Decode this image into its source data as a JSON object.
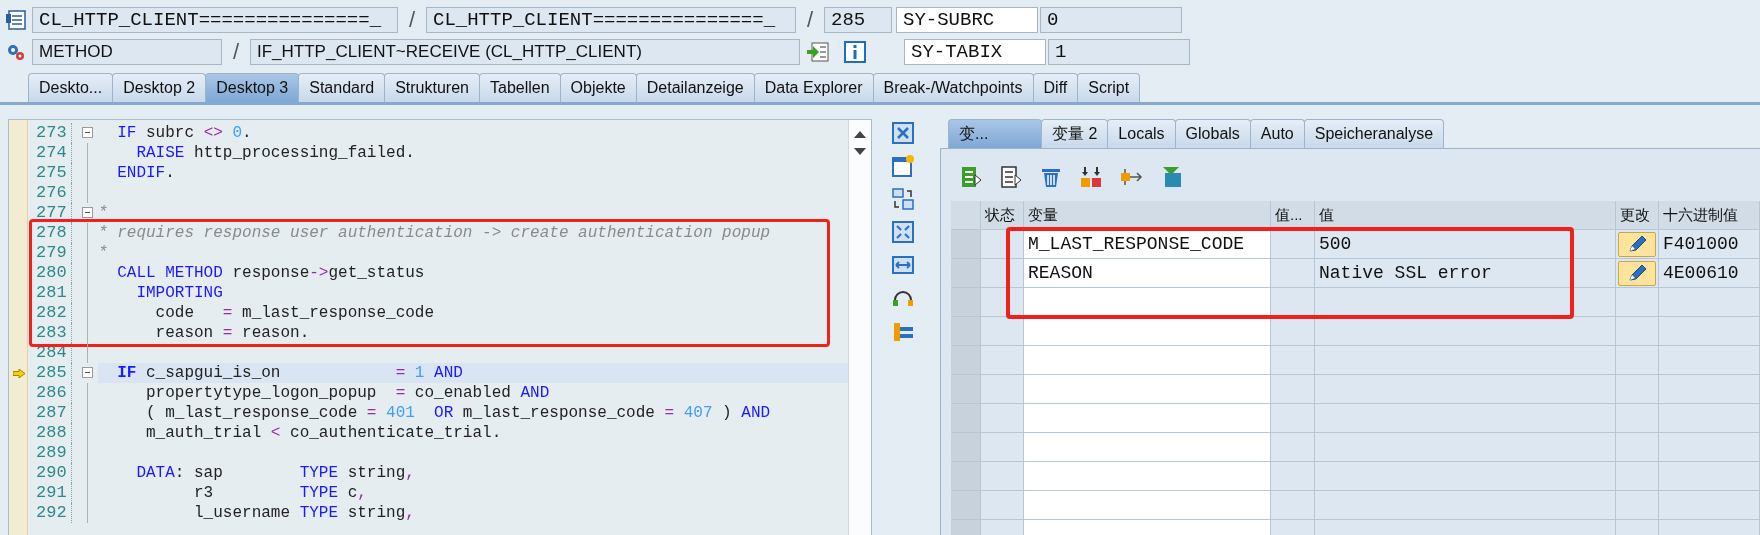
{
  "header": {
    "row_1": [
      {
        "kind": "field",
        "value": "CL_HTTP_CLIENT===============_"
      },
      {
        "kind": "separator",
        "text": "/"
      },
      {
        "kind": "field",
        "value": "CL_HTTP_CLIENT===============_"
      },
      {
        "kind": "separator",
        "text": "/"
      },
      {
        "kind": "field",
        "value": "285"
      }
    ],
    "row_2": [
      {
        "kind": "field",
        "value": "METHOD"
      },
      {
        "kind": "separator",
        "text": "/"
      },
      {
        "kind": "field",
        "value": "IF_HTTP_CLIENT~RECEIVE (CL_HTTP_CLIENT)"
      }
    ],
    "system_fields": [
      {
        "name": "SY-SUBRC",
        "value": "0"
      },
      {
        "name": "SY-TABIX",
        "value": "1"
      }
    ]
  },
  "tabs": [
    {
      "label": "Deskto...",
      "selected": false
    },
    {
      "label": "Desktop 2",
      "selected": false
    },
    {
      "label": "Desktop 3",
      "selected": true
    },
    {
      "label": "Standard",
      "selected": false
    },
    {
      "label": "Strukturen",
      "selected": false
    },
    {
      "label": "Tabellen",
      "selected": false
    },
    {
      "label": "Objekte",
      "selected": false
    },
    {
      "label": "Detailanzeige",
      "selected": false
    },
    {
      "label": "Data Explorer",
      "selected": false
    },
    {
      "label": "Break-/Watchpoints",
      "selected": false
    },
    {
      "label": "Diff",
      "selected": false
    },
    {
      "label": "Script",
      "selected": false
    }
  ],
  "code": {
    "blocks": [
      {
        "framed": false,
        "lines": [
          {
            "number": "273",
            "collapsible": true,
            "current": false,
            "tokens": [
              {
                "kind": "kw",
                "text": "  IF"
              },
              {
                "kind": "txt",
                "text": " subrc "
              },
              {
                "kind": "op",
                "text": "<>"
              },
              {
                "kind": "num",
                "text": " 0"
              },
              {
                "kind": "txt",
                "text": "."
              }
            ]
          },
          {
            "number": "274",
            "collapsible": false,
            "current": false,
            "tokens": [
              {
                "kind": "kw",
                "text": "    RAISE"
              },
              {
                "kind": "txt",
                "text": " http_processing_failed."
              }
            ]
          },
          {
            "number": "275",
            "collapsible": false,
            "current": false,
            "tokens": [
              {
                "kind": "kw",
                "text": "  ENDIF"
              },
              {
                "kind": "txt",
                "text": "."
              }
            ]
          },
          {
            "number": "276",
            "collapsible": false,
            "current": false
          },
          {
            "number": "277",
            "collapsible": true,
            "current": false,
            "tokens": [
              {
                "kind": "cmt",
                "text": "*"
              }
            ]
          }
        ]
      },
      {
        "framed": true,
        "lines": [
          {
            "number": "278",
            "collapsible": false,
            "current": false,
            "tokens": [
              {
                "kind": "cmt",
                "text": "* requires response user authentication -> create authentication popup"
              }
            ]
          },
          {
            "number": "279",
            "collapsible": false,
            "current": false,
            "tokens": [
              {
                "kind": "cmt",
                "text": "*"
              }
            ]
          },
          {
            "number": "280",
            "collapsible": false,
            "current": false,
            "tokens": [
              {
                "kind": "kw",
                "text": "  CALL METHOD"
              },
              {
                "kind": "txt",
                "text": " response"
              },
              {
                "kind": "op",
                "text": "->"
              },
              {
                "kind": "txt",
                "text": "get_status"
              }
            ]
          },
          {
            "number": "281",
            "collapsible": false,
            "current": false,
            "tokens": [
              {
                "kind": "kw",
                "text": "    IMPORTING"
              }
            ]
          },
          {
            "number": "282",
            "collapsible": false,
            "current": false,
            "tokens": [
              {
                "kind": "txt",
                "text": "      code   "
              },
              {
                "kind": "op",
                "text": "="
              },
              {
                "kind": "txt",
                "text": " m_last_response_code"
              }
            ]
          },
          {
            "number": "283",
            "collapsible": false,
            "current": false,
            "tokens": [
              {
                "kind": "txt",
                "text": "      reason "
              },
              {
                "kind": "op",
                "text": "="
              },
              {
                "kind": "txt",
                "text": " reason."
              }
            ]
          }
        ]
      },
      {
        "framed": false,
        "lines": [
          {
            "number": "284",
            "collapsible": false,
            "current": false
          },
          {
            "number": "285",
            "collapsible": true,
            "current": true,
            "tokens": [
              {
                "kind": "kw",
                "text": "  IF"
              },
              {
                "kind": "txt",
                "text": " c_sapgui_is_on            "
              },
              {
                "kind": "op",
                "text": "="
              },
              {
                "kind": "num",
                "text": " 1"
              },
              {
                "kind": "kw",
                "text": " AND"
              }
            ]
          },
          {
            "number": "286",
            "collapsible": false,
            "current": false,
            "tokens": [
              {
                "kind": "txt",
                "text": "     propertytype_logon_popup  "
              },
              {
                "kind": "op",
                "text": "="
              },
              {
                "kind": "txt",
                "text": " co_enabled "
              },
              {
                "kind": "kw",
                "text": "AND"
              }
            ]
          },
          {
            "number": "287",
            "collapsible": false,
            "current": false,
            "tokens": [
              {
                "kind": "txt",
                "text": "     ( m_last_response_code "
              },
              {
                "kind": "op",
                "text": "="
              },
              {
                "kind": "num",
                "text": " 401"
              },
              {
                "kind": "kw",
                "text": "  OR"
              },
              {
                "kind": "txt",
                "text": " m_last_response_code "
              },
              {
                "kind": "op",
                "text": "="
              },
              {
                "kind": "num",
                "text": " 407"
              },
              {
                "kind": "txt",
                "text": " ) "
              },
              {
                "kind": "kw",
                "text": "AND"
              }
            ]
          },
          {
            "number": "288",
            "collapsible": false,
            "current": false,
            "tokens": [
              {
                "kind": "txt",
                "text": "     m_auth_trial "
              },
              {
                "kind": "op",
                "text": "<"
              },
              {
                "kind": "txt",
                "text": " co_authenticate_trial."
              }
            ]
          },
          {
            "number": "289",
            "collapsible": false,
            "current": false
          },
          {
            "number": "290",
            "collapsible": false,
            "current": false,
            "tokens": [
              {
                "kind": "kw",
                "text": "    DATA"
              },
              {
                "kind": "txt",
                "text": ": sap        "
              },
              {
                "kind": "kw",
                "text": "TYPE"
              },
              {
                "kind": "txt",
                "text": " string"
              },
              {
                "kind": "op",
                "text": ","
              }
            ]
          },
          {
            "number": "291",
            "collapsible": false,
            "current": false,
            "tokens": [
              {
                "kind": "txt",
                "text": "          r3         "
              },
              {
                "kind": "kw",
                "text": "TYPE"
              },
              {
                "kind": "txt",
                "text": " c"
              },
              {
                "kind": "op",
                "text": ","
              }
            ]
          },
          {
            "number": "292",
            "collapsible": false,
            "current": false,
            "tokens": [
              {
                "kind": "txt",
                "text": "          l_username "
              },
              {
                "kind": "kw",
                "text": "TYPE"
              },
              {
                "kind": "txt",
                "text": " string"
              },
              {
                "kind": "op",
                "text": ","
              }
            ]
          }
        ]
      }
    ]
  },
  "variables": {
    "tabs": [
      {
        "label": "变...",
        "selected": true
      },
      {
        "label": "变量 2",
        "selected": false
      },
      {
        "label": "Locals",
        "selected": false
      },
      {
        "label": "Globals",
        "selected": false
      },
      {
        "label": "Auto",
        "selected": false
      },
      {
        "label": "Speicheranalyse",
        "selected": false
      }
    ],
    "columns": [
      "状态",
      "变量",
      "值...",
      "值",
      "更改",
      "十六进制值"
    ],
    "rows": [
      {
        "variable": "M_LAST_RESPONSE_CODE",
        "value": "500",
        "hex": "F401000",
        "boxed": true
      },
      {
        "variable": "REASON",
        "value": "Native SSL error",
        "hex": "4E00610",
        "boxed": true
      }
    ]
  }
}
